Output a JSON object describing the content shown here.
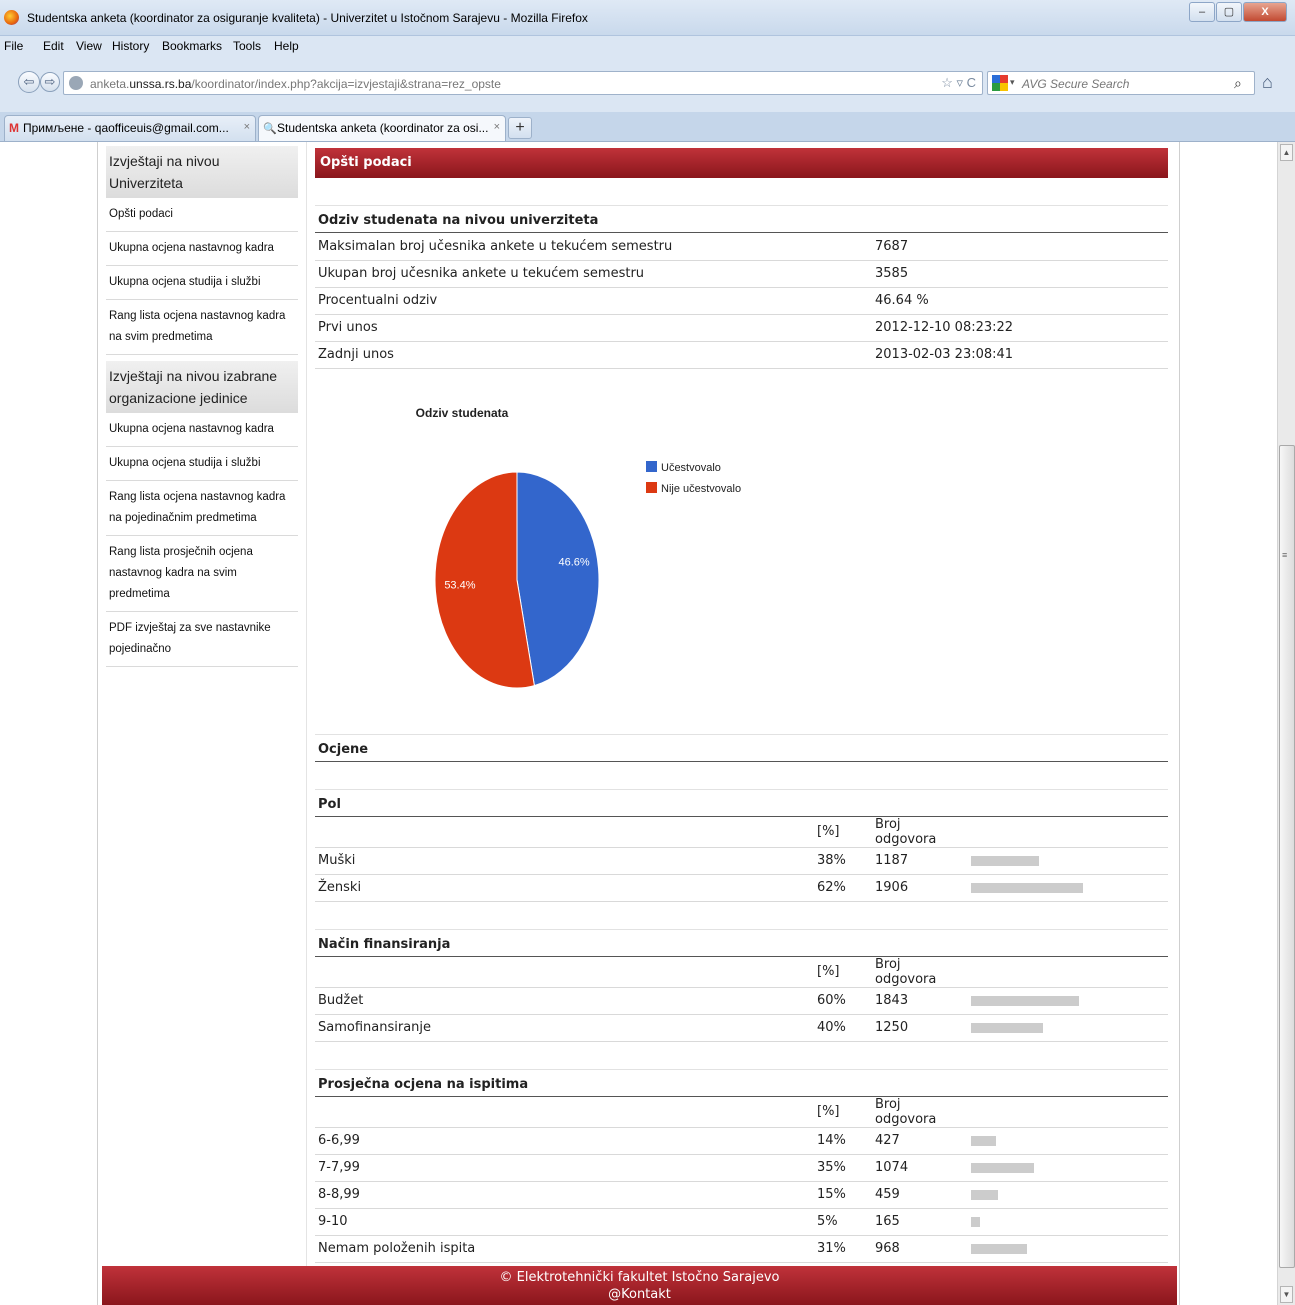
{
  "window": {
    "title": "Studentska anketa (koordinator za osiguranje kvaliteta) - Univerzitet u Istočnom Sarajevu - Mozilla Firefox",
    "buttons": {
      "minimize": "–",
      "maximize": "▢",
      "close": "X"
    }
  },
  "menu": [
    "File",
    "Edit",
    "View",
    "History",
    "Bookmarks",
    "Tools",
    "Help"
  ],
  "address": {
    "host_prefix": "anketa.",
    "host_bold": "unssa.rs.ba",
    "path": "/koordinator/index.php?akcija=izvjestaji&strana=rez_opste",
    "icons": "☆ ▿ C"
  },
  "search": {
    "placeholder": "AVG Secure Search",
    "dropdown": "▾"
  },
  "tabs": [
    {
      "favicon": "M",
      "label": "Примљене - qaofficeuis@gmail.com...",
      "close": "×"
    },
    {
      "favicon": "🔍",
      "label": "Studentska anketa (koordinator za osi...",
      "close": "×"
    }
  ],
  "new_tab": "+",
  "sidebar": {
    "university_heading": "Izvještaji na nivou Univerziteta",
    "university_links": [
      "Opšti podaci",
      "Ukupna ocjena nastavnog kadra",
      "Ukupna ocjena studija i službi",
      "Rang lista ocjena nastavnog kadra na svim predmetima"
    ],
    "unit_heading": "Izvještaji na nivou izabrane organizacione jedinice",
    "unit_links": [
      "Ukupna ocjena nastavnog kadra",
      "Ukupna ocjena studija i službi",
      "Rang lista ocjena nastavnog kadra na pojedinačnim predmetima",
      "Rang lista prosječnih ocjena nastavnog kadra na svim predmetima",
      "PDF izvještaj za sve nastavnike pojedinačno"
    ]
  },
  "main": {
    "section_title": "Opšti podaci",
    "response_heading": "Odziv studenata na nivou univerziteta",
    "response_rows": [
      {
        "label": "Maksimalan broj učesnika ankete u tekućem semestru",
        "value": "7687"
      },
      {
        "label": "Ukupan broj učesnika ankete u tekućem semestru",
        "value": "3585"
      },
      {
        "label": "Procentualni odziv",
        "value": "46.64 %"
      },
      {
        "label": "Prvi unos",
        "value": "2012-12-10 08:23:22"
      },
      {
        "label": "Zadnji unos",
        "value": "2013-02-03 23:08:41"
      }
    ],
    "ratings_heading": "Ocjene",
    "col_percent": "[%]",
    "col_count": "Broj odgovora",
    "groups": [
      {
        "title": "Pol",
        "rows": [
          {
            "label": "Muški",
            "percent": "38%",
            "count": "1187",
            "share": 38
          },
          {
            "label": "Ženski",
            "percent": "62%",
            "count": "1906",
            "share": 62
          }
        ]
      },
      {
        "title": "Način finansiranja",
        "rows": [
          {
            "label": "Budžet",
            "percent": "60%",
            "count": "1843",
            "share": 60
          },
          {
            "label": "Samofinansiranje",
            "percent": "40%",
            "count": "1250",
            "share": 40
          }
        ]
      },
      {
        "title": "Prosječna ocjena na ispitima",
        "rows": [
          {
            "label": "6-6,99",
            "percent": "14%",
            "count": "427",
            "share": 14
          },
          {
            "label": "7-7,99",
            "percent": "35%",
            "count": "1074",
            "share": 35
          },
          {
            "label": "8-8,99",
            "percent": "15%",
            "count": "459",
            "share": 15
          },
          {
            "label": "9-10",
            "percent": "5%",
            "count": "165",
            "share": 5
          },
          {
            "label": "Nemam položenih ispita",
            "percent": "31%",
            "count": "968",
            "share": 31
          }
        ]
      }
    ]
  },
  "footer": {
    "line1": "© Elektrotehnički fakultet Istočno Sarajevo",
    "line2": "@Kontakt"
  },
  "colors": {
    "accent": "#a8232b",
    "pie_participated": "#3366cc",
    "pie_not_participated": "#dc3912",
    "bar": "#cccccc"
  },
  "chart_data": {
    "type": "pie",
    "title": "Odziv studenata",
    "categories": [
      "Učestvovalo",
      "Nije učestvovalo"
    ],
    "values": [
      46.6,
      53.4
    ],
    "data_labels": [
      "46.6%",
      "53.4%"
    ],
    "legend_position": "right",
    "colors": [
      "#3366cc",
      "#dc3912"
    ]
  }
}
